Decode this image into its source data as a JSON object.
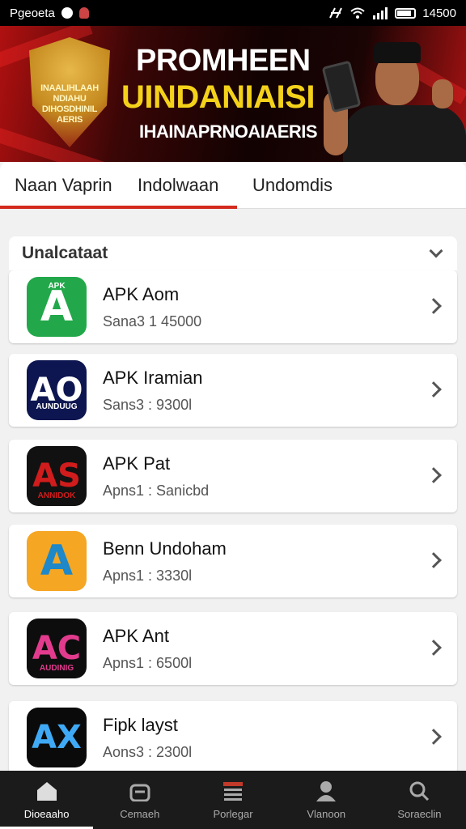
{
  "status_bar": {
    "carrier": "Pgeoeta",
    "time": "14500"
  },
  "banner": {
    "crest_lines": [
      "INAALIHLAAH",
      "NDIAHU",
      "DIHOSDHINIL",
      "AERIS"
    ],
    "title": "PROMHEEN",
    "subtitle": "UINDANIAISI",
    "tagline": "IHAINAPRNOAIAERIS"
  },
  "tabs": [
    {
      "label": "Naan Vaprin",
      "active": true
    },
    {
      "label": "Indolwaan",
      "active": false
    },
    {
      "label": "Undomdis",
      "active": false
    }
  ],
  "section": {
    "title": "Unalcataat"
  },
  "apps": [
    {
      "name": "APK Aom",
      "meta": "Sana3 1 45000",
      "icon": "apk-green-a-icon",
      "icon_text": "A",
      "icon_small": "APK",
      "icon_bg": "#22a84a",
      "icon_fg": "#ffffff"
    },
    {
      "name": "APK Iramian",
      "meta": "Sans3 : 9300l",
      "icon": "apk-navy-ao-icon",
      "icon_text": "AO",
      "icon_small": "AUNDUUG",
      "icon_bg": "#0d1650",
      "icon_fg": "#ffffff"
    },
    {
      "name": "APK Pat",
      "meta": "Apns1 : Sanicbd",
      "icon": "apk-black-as-icon",
      "icon_text": "AS",
      "icon_small": "ANNIDOK",
      "icon_bg": "#111111",
      "icon_fg": "#d01c1c"
    },
    {
      "name": "Benn Undoham",
      "meta": "Apns1 : 3330l",
      "icon": "apk-orange-a-icon",
      "icon_text": "A",
      "icon_small": "",
      "icon_bg": "#f5a623",
      "icon_fg": "#1e88c8"
    },
    {
      "name": "APK Ant",
      "meta": "Apns1 : 6500l",
      "icon": "apk-black-ac-icon",
      "icon_text": "AC",
      "icon_small": "AUDINIG",
      "icon_bg": "#0d0d0d",
      "icon_fg": "#e23b8e"
    },
    {
      "name": "Fipk layst",
      "meta": "Aons3 : 2300l",
      "icon": "apk-black-ax-icon",
      "icon_text": "AX",
      "icon_small": "",
      "icon_bg": "#0a0a0a",
      "icon_fg": "#3fa9f5"
    }
  ],
  "bottom_nav": [
    {
      "label": "Dioeaaho",
      "icon": "home-icon",
      "active": true
    },
    {
      "label": "Cemaeh",
      "icon": "bag-icon",
      "active": false
    },
    {
      "label": "Porlegar",
      "icon": "store-icon",
      "active": false
    },
    {
      "label": "Vlanoon",
      "icon": "person-icon",
      "active": false
    },
    {
      "label": "Soraeclin",
      "icon": "search-icon",
      "active": false
    }
  ]
}
